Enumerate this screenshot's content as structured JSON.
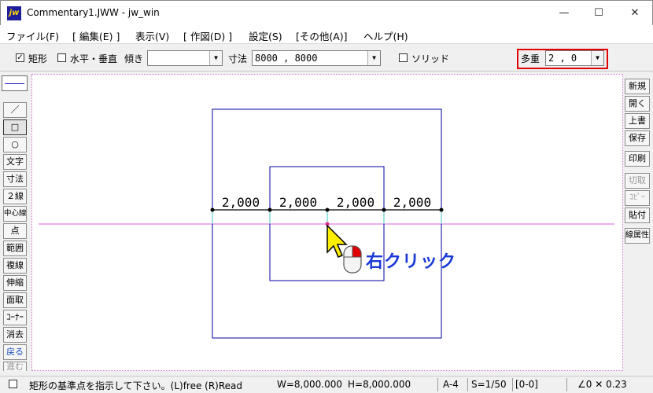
{
  "window": {
    "title": "Commentary1.JWW - jw_win",
    "app_icon": "jw",
    "minimize": "—",
    "maximize": "☐",
    "close": "✕"
  },
  "menu": [
    "ファイル(F)",
    "[ 編集(E) ]",
    "表示(V)",
    "[ 作図(D) ]",
    "設定(S)",
    "[その他(A)]",
    "ヘルプ(H)"
  ],
  "controls": {
    "rect_check": {
      "label": "矩形",
      "checked": true
    },
    "hv_check": {
      "label": "水平・垂直",
      "checked": false
    },
    "tilt_label": "傾き",
    "tilt_value": "",
    "dim_label": "寸法",
    "dim_value": "8000 , 8000",
    "solid_check": {
      "label": "ソリッド",
      "checked": false
    },
    "multi_label": "多重",
    "multi_value": "2 , 0"
  },
  "left_tools": [
    "／",
    "□",
    "○",
    "文字",
    "寸法",
    "２線",
    "中心線",
    "点",
    "範囲",
    "複線",
    "伸縮",
    "面取",
    "ｺｰﾅｰ",
    "消去",
    "戻る",
    "進む"
  ],
  "right_tools": [
    {
      "label": "新規",
      "enabled": true
    },
    {
      "label": "開く",
      "enabled": true
    },
    {
      "label": "上書",
      "enabled": true
    },
    {
      "label": "保存",
      "enabled": true
    },
    {
      "label": "印刷",
      "enabled": true
    },
    {
      "label": "切取",
      "enabled": false
    },
    {
      "label": "ｺﾋﾟｰ",
      "enabled": false
    },
    {
      "label": "貼付",
      "enabled": true
    },
    {
      "label": "線属性",
      "enabled": true
    }
  ],
  "canvas": {
    "dimensions": [
      "2,000",
      "2,000",
      "2,000",
      "2,000"
    ],
    "annotation": "右クリック",
    "icons": {
      "cursor": "arrow-cursor-icon",
      "mouse": "mouse-right-click-icon"
    },
    "colors": {
      "rect": "#0000a0",
      "guide": "#e060e0",
      "dim_line": "#000000",
      "cursor": "#ffee00",
      "annotation": "#1a3ad8"
    }
  },
  "status": {
    "message": "矩形の基準点を指示して下さい。(L)free (R)Read",
    "width": "W=8,000.000",
    "height": "H=8,000.000",
    "paper": "A-4",
    "scale": "S=1/50",
    "layer": "[0-0]",
    "zoom": "∠0  ✕ 0.23"
  }
}
